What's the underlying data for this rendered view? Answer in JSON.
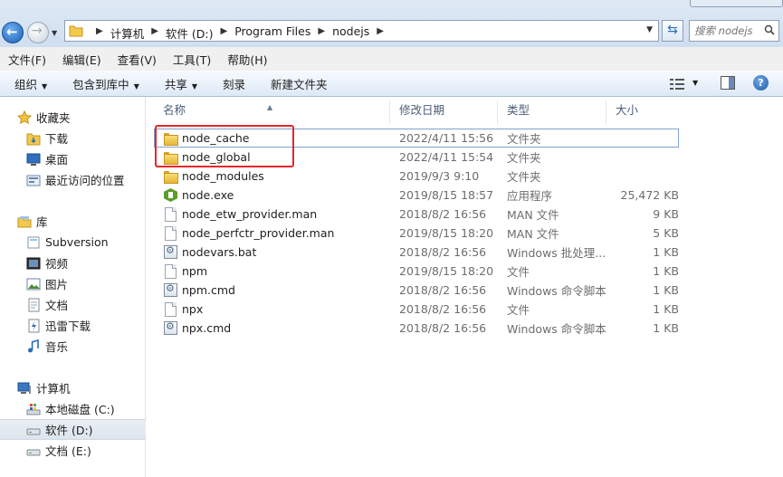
{
  "address": {
    "crumbs": [
      "计算机",
      "软件 (D:)",
      "Program Files",
      "nodejs"
    ]
  },
  "search": {
    "placeholder": "搜索 nodejs"
  },
  "menu": [
    "文件(F)",
    "编辑(E)",
    "查看(V)",
    "工具(T)",
    "帮助(H)"
  ],
  "toolbar": {
    "organize": "组织",
    "include_in_library": "包含到库中",
    "share": "共享",
    "burn": "刻录",
    "new_folder": "新建文件夹"
  },
  "sidebar": {
    "favorites": {
      "label": "收藏夹",
      "items": [
        "下载",
        "桌面",
        "最近访问的位置"
      ]
    },
    "libraries": {
      "label": "库",
      "items": [
        "Subversion",
        "视频",
        "图片",
        "文档",
        "迅雷下载",
        "音乐"
      ]
    },
    "computer": {
      "label": "计算机",
      "items": [
        "本地磁盘 (C:)",
        "软件 (D:)",
        "文档 (E:)"
      ],
      "selected": "软件 (D:)"
    }
  },
  "columns": {
    "name": "名称",
    "date": "修改日期",
    "type": "类型",
    "size": "大小"
  },
  "files": [
    {
      "name": "node_cache",
      "date": "2022/4/11 15:56",
      "type": "文件夹",
      "size": "",
      "icon": "folder-icon"
    },
    {
      "name": "node_global",
      "date": "2022/4/11 15:54",
      "type": "文件夹",
      "size": "",
      "icon": "folder-icon"
    },
    {
      "name": "node_modules",
      "date": "2019/9/3 9:10",
      "type": "文件夹",
      "size": "",
      "icon": "folder-icon"
    },
    {
      "name": "node.exe",
      "date": "2019/8/15 18:57",
      "type": "应用程序",
      "size": "25,472 KB",
      "icon": "node-exe-icon"
    },
    {
      "name": "node_etw_provider.man",
      "date": "2018/8/2 16:56",
      "type": "MAN 文件",
      "size": "9 KB",
      "icon": "file-icon"
    },
    {
      "name": "node_perfctr_provider.man",
      "date": "2019/8/15 18:20",
      "type": "MAN 文件",
      "size": "5 KB",
      "icon": "file-icon"
    },
    {
      "name": "nodevars.bat",
      "date": "2018/8/2 16:56",
      "type": "Windows 批处理...",
      "size": "1 KB",
      "icon": "batch-file-icon"
    },
    {
      "name": "npm",
      "date": "2019/8/15 18:20",
      "type": "文件",
      "size": "1 KB",
      "icon": "file-icon"
    },
    {
      "name": "npm.cmd",
      "date": "2018/8/2 16:56",
      "type": "Windows 命令脚本",
      "size": "1 KB",
      "icon": "batch-file-icon"
    },
    {
      "name": "npx",
      "date": "2018/8/2 16:56",
      "type": "文件",
      "size": "1 KB",
      "icon": "file-icon"
    },
    {
      "name": "npx.cmd",
      "date": "2018/8/2 16:56",
      "type": "Windows 命令脚本",
      "size": "1 KB",
      "icon": "batch-file-icon"
    }
  ],
  "colors": {
    "highlight_box": "#e8262a",
    "accent": "#2b6bb8"
  }
}
